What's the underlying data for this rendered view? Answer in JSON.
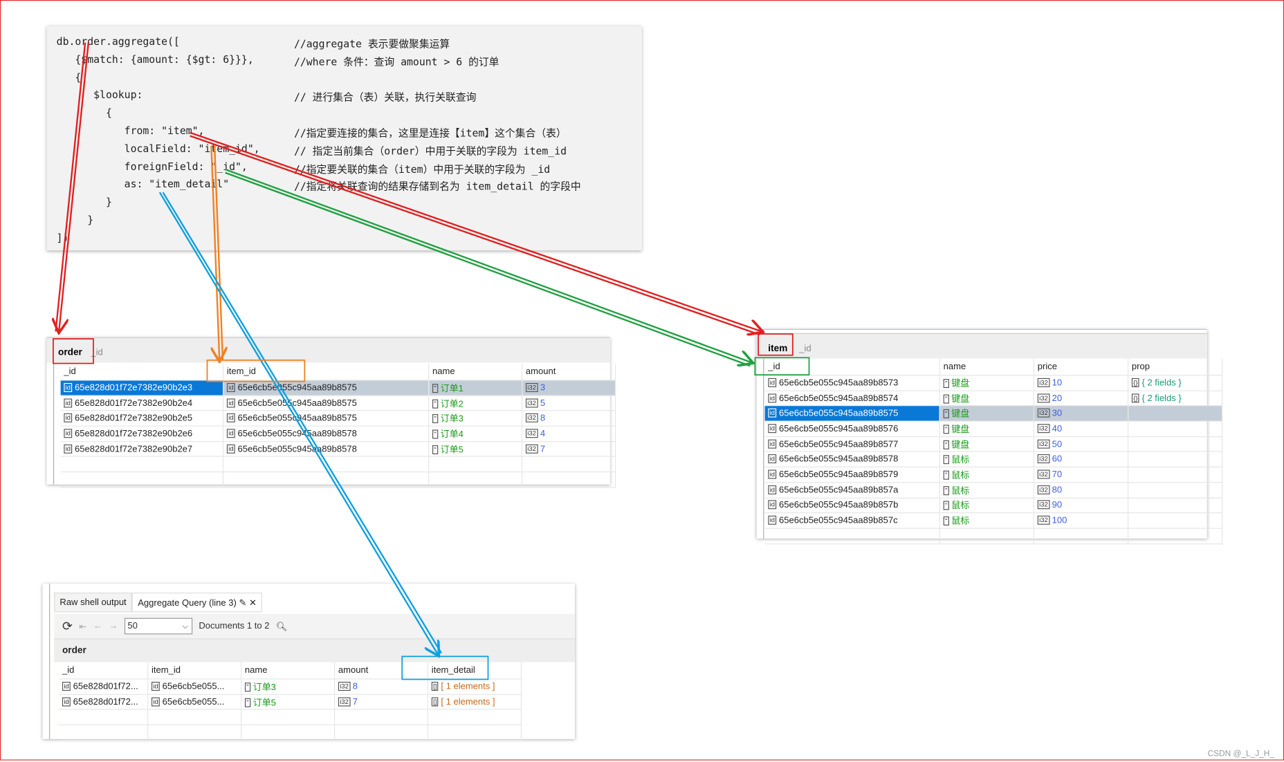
{
  "code": {
    "lines": [
      {
        "code": "db.order.aggregate([",
        "comment": "//aggregate 表示要做聚集运算"
      },
      {
        "code": "   {$match: {amount: {$gt: 6}}},",
        "comment": "//where 条件：查询 amount > 6 的订单"
      },
      {
        "code": "   {",
        "comment": ""
      },
      {
        "code": "      $lookup:",
        "comment": "// 进行集合（表）关联，执行关联查询"
      },
      {
        "code": "        {",
        "comment": ""
      },
      {
        "code": "           from: \"item\",",
        "comment": "//指定要连接的集合，这里是连接【item】这个集合（表）"
      },
      {
        "code": "           localField: \"item_id\",",
        "comment": "// 指定当前集合（order）中用于关联的字段为 item_id"
      },
      {
        "code": "           foreignField: \"_id\",",
        "comment": "//指定要关联的集合（item）中用于关联的字段为 _id"
      },
      {
        "code": "           as: \"item_detail\"",
        "comment": "//指定将关联查询的结果存储到名为 item_detail 的字段中"
      },
      {
        "code": "        }",
        "comment": ""
      },
      {
        "code": "     }",
        "comment": ""
      },
      {
        "code": "])",
        "comment": ""
      }
    ]
  },
  "order_table": {
    "collection": "order",
    "path": "_id",
    "columns": [
      "_id",
      "item_id",
      "name",
      "amount"
    ],
    "rows": [
      [
        "65e828d01f72e7382e90b2e3",
        "65e6cb5e055c945aa89b8575",
        "订单1",
        "3"
      ],
      [
        "65e828d01f72e7382e90b2e4",
        "65e6cb5e055c945aa89b8575",
        "订单2",
        "5"
      ],
      [
        "65e828d01f72e7382e90b2e5",
        "65e6cb5e055c945aa89b8575",
        "订单3",
        "8"
      ],
      [
        "65e828d01f72e7382e90b2e6",
        "65e6cb5e055c945aa89b8578",
        "订单4",
        "4"
      ],
      [
        "65e828d01f72e7382e90b2e7",
        "65e6cb5e055c945aa89b8578",
        "订单5",
        "7"
      ]
    ],
    "selected_row": 0
  },
  "item_table": {
    "collection": "item",
    "path": "_id",
    "columns": [
      "_id",
      "name",
      "price",
      "prop"
    ],
    "rows": [
      [
        "65e6cb5e055c945aa89b8573",
        "键盘",
        "10",
        "{ 2 fields }"
      ],
      [
        "65e6cb5e055c945aa89b8574",
        "键盘",
        "20",
        "{ 2 fields }"
      ],
      [
        "65e6cb5e055c945aa89b8575",
        "键盘",
        "30",
        ""
      ],
      [
        "65e6cb5e055c945aa89b8576",
        "键盘",
        "40",
        ""
      ],
      [
        "65e6cb5e055c945aa89b8577",
        "键盘",
        "50",
        ""
      ],
      [
        "65e6cb5e055c945aa89b8578",
        "鼠标",
        "60",
        ""
      ],
      [
        "65e6cb5e055c945aa89b8579",
        "鼠标",
        "70",
        ""
      ],
      [
        "65e6cb5e055c945aa89b857a",
        "鼠标",
        "80",
        ""
      ],
      [
        "65e6cb5e055c945aa89b857b",
        "鼠标",
        "90",
        ""
      ],
      [
        "65e6cb5e055c945aa89b857c",
        "鼠标",
        "100",
        ""
      ]
    ],
    "selected_row": 2
  },
  "result": {
    "tabs": [
      "Raw shell output",
      "Aggregate Query (line 3)"
    ],
    "page_size": "50",
    "doc_range": "Documents 1 to 2",
    "collection": "order",
    "columns": [
      "_id",
      "item_id",
      "name",
      "amount",
      "item_detail"
    ],
    "rows": [
      [
        "65e828d01f72...",
        "65e6cb5e055...",
        "订单3",
        "8",
        "[ 1 elements ]"
      ],
      [
        "65e828d01f72...",
        "65e6cb5e055...",
        "订单5",
        "7",
        "[ 1 elements ]"
      ]
    ]
  },
  "watermark": "CSDN @_L_J_H_",
  "colors": {
    "red": "#e02020",
    "orange": "#f08020",
    "green": "#20a040",
    "blue": "#10a0e0",
    "selection": "#0a78d7"
  }
}
